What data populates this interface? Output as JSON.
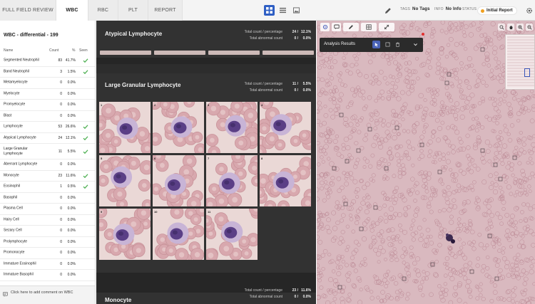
{
  "topbar": {
    "tabs": [
      {
        "label": "FULL FIELD REVIEW"
      },
      {
        "label": "WBC"
      },
      {
        "label": "RBC"
      },
      {
        "label": "PLT"
      },
      {
        "label": "REPORT"
      }
    ],
    "tags_label": "TAGS",
    "tags_value": "No Tags",
    "info_label": "INFO",
    "info_value": "No Info",
    "status_label": "STATUS",
    "status_value": "Initial Report"
  },
  "left": {
    "title": "WBC - differential - 199",
    "columns": {
      "name": "Name",
      "count": "Count",
      "percent": "%",
      "seen": "Seen"
    },
    "rows": [
      {
        "name": "Segmented Neutrophil",
        "count": "83",
        "percent": "41.7%",
        "seen": true
      },
      {
        "name": "Band Neutrophil",
        "count": "3",
        "percent": "1.5%",
        "seen": true
      },
      {
        "name": "Metamyelocyte",
        "count": "0",
        "percent": "0.0%",
        "seen": false
      },
      {
        "name": "Myelocyte",
        "count": "0",
        "percent": "0.0%",
        "seen": false
      },
      {
        "name": "Promyelocyte",
        "count": "0",
        "percent": "0.0%",
        "seen": false
      },
      {
        "name": "Blast",
        "count": "0",
        "percent": "0.0%",
        "seen": false
      },
      {
        "name": "Lymphocyte",
        "count": "53",
        "percent": "26.6%",
        "seen": true
      },
      {
        "name": "Atypical Lymphocyte",
        "count": "24",
        "percent": "12.1%",
        "seen": true
      },
      {
        "name": "Large Granular Lymphocyte",
        "count": "11",
        "percent": "5.5%",
        "seen": true
      },
      {
        "name": "Aberrant Lymphocyte",
        "count": "0",
        "percent": "0.0%",
        "seen": false
      },
      {
        "name": "Monocyte",
        "count": "23",
        "percent": "11.6%",
        "seen": true
      },
      {
        "name": "Eosinophil",
        "count": "1",
        "percent": "0.5%",
        "seen": true
      },
      {
        "name": "Basophil",
        "count": "0",
        "percent": "0.0%",
        "seen": false
      },
      {
        "name": "Plasma Cell",
        "count": "0",
        "percent": "0.0%",
        "seen": false
      },
      {
        "name": "Hairy Cell",
        "count": "0",
        "percent": "0.0%",
        "seen": false
      },
      {
        "name": "Sezary Cell",
        "count": "0",
        "percent": "0.0%",
        "seen": false
      },
      {
        "name": "Prolymphocyte",
        "count": "0",
        "percent": "0.0%",
        "seen": false
      },
      {
        "name": "Promonocyte",
        "count": "0",
        "percent": "0.0%",
        "seen": false
      },
      {
        "name": "Immature Eosinophil",
        "count": "0",
        "percent": "0.0%",
        "seen": false
      },
      {
        "name": "Immature Basophil",
        "count": "0",
        "percent": "0.0%",
        "seen": false
      }
    ],
    "comment_placeholder": "Click here to add comment on WBC"
  },
  "middle": {
    "sections": [
      {
        "title": "Atypical Lymphocyte",
        "total_count_label": "Total count",
        "total_count_sep": "/",
        "percentage_label": "percentage",
        "total_value": "24 /",
        "total_pct": "12.1%",
        "abnormal_label": "Total abnormal count",
        "abnormal_value": "0 /",
        "abnormal_pct": "0.0%"
      },
      {
        "title": "Large Granular Lymphocyte",
        "total_count_label": "Total count",
        "total_count_sep": "/",
        "percentage_label": "percentage",
        "total_value": "11 /",
        "total_pct": "5.5%",
        "abnormal_label": "Total abnormal count",
        "abnormal_value": "0 /",
        "abnormal_pct": "0.0%"
      },
      {
        "title": "Monocyte",
        "total_count_label": "Total count",
        "total_count_sep": "/",
        "percentage_label": "percentage",
        "total_value": "23 /",
        "total_pct": "11.6%",
        "abnormal_label": "Total abnormal count",
        "abnormal_value": "0 /",
        "abnormal_pct": "0.0%"
      }
    ],
    "cell_labels": [
      "1",
      "2",
      "3",
      "4",
      "5",
      "6",
      "7",
      "8",
      "9",
      "10",
      "11"
    ]
  },
  "viewer": {
    "analysis_title": "Analysis Results"
  },
  "colors": {
    "accent": "#2f5fc4",
    "status": "#f0a020",
    "check": "#4caf50",
    "dark_panel": "#2d2d2d"
  },
  "icons": {
    "grid_view": "grid-icon",
    "list_view": "list-icon",
    "image_view": "image-icon",
    "edit": "pencil-icon",
    "settings": "gear-icon",
    "seen": "check-icon",
    "comment": "comment-icon"
  }
}
